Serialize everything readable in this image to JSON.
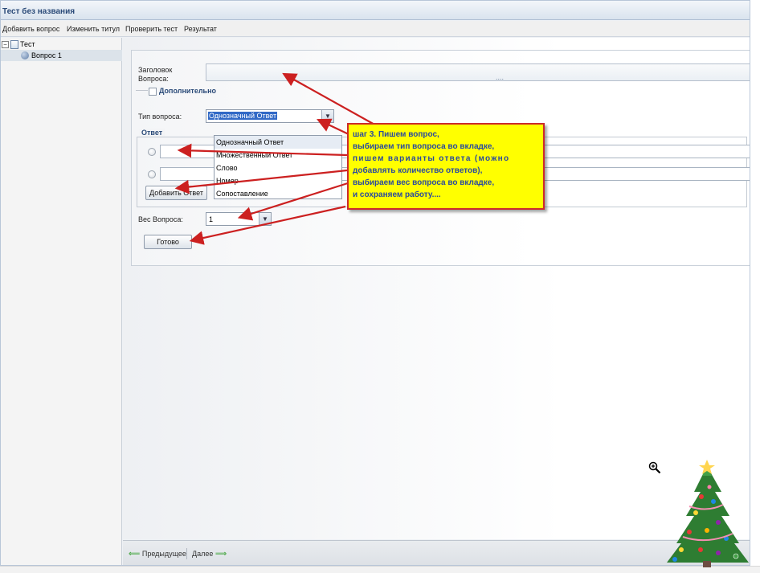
{
  "window": {
    "title": "Тест без названия"
  },
  "menu": {
    "items": [
      "Добавить вопрос",
      "Изменить титул",
      "Проверить тест",
      "Результат"
    ]
  },
  "tree": {
    "root_label": "Тест",
    "toggle_symbol": "−",
    "child_label": "Вопрос 1"
  },
  "form": {
    "title_label_line1": "Заголовок",
    "title_label_line2": "Вопроса:",
    "title_value": "",
    "title_dots": "....",
    "extra_label": "Дополнительно",
    "type_label": "Тип вопроса:",
    "type_selected": "Однозначный Ответ",
    "type_options": [
      "Однозначный Ответ",
      "Множественный Ответ",
      "Слово",
      "Номер",
      "Сопоставление"
    ],
    "answer_legend": "Ответ",
    "add_answer_label": "Добавить Ответ",
    "weight_label": "Вес Вопроса:",
    "weight_value": "1",
    "done_label": "Готово"
  },
  "nav": {
    "prev_label": "Предыдущее",
    "next_label": "Далее",
    "prev_arrow": "⟸",
    "next_arrow": "⟹"
  },
  "callout": {
    "lines": [
      "шаг 3. Пишем вопрос,",
      "выбираем тип вопроса во вкладке,",
      "пишем варианты ответа (можно",
      "добавлять количество ответов),",
      "выбираем вес вопроса во вкладке,",
      "и сохраняем работу...."
    ]
  },
  "colors": {
    "arrow": "#cc2020",
    "callout_bg": "#ffff00",
    "callout_text": "#2a4a9e",
    "title_text": "#2a4a78",
    "selected_option_bg": "#3169c6"
  },
  "icons": {
    "zoom": "zoom-in-icon",
    "tree_toggle": "tree-collapse-icon",
    "test_node": "document-icon",
    "question_node": "question-icon",
    "dropdown": "chevron-down-icon",
    "decoration": "christmas-tree-icon"
  }
}
